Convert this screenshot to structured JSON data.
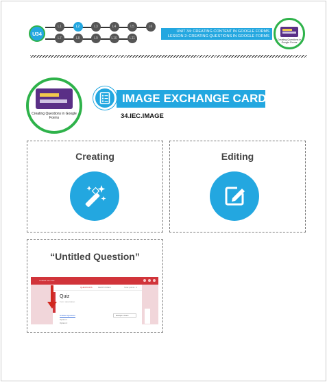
{
  "header": {
    "unit_badge": "U34",
    "lesson_dots_row1": [
      "L1",
      "L2",
      "L3",
      "L4",
      "L5",
      "L6"
    ],
    "lesson_dots_row2": [
      "L7",
      "L8",
      "L9",
      "L10",
      "L11"
    ],
    "active_lesson": "L2",
    "unit_title": "UNIT 34: CREATING CONTENT IN GOOGLE FORMS",
    "lesson_title": "LESSON 2: CREATING QUESTIONS IN GOOGLE FORMS",
    "thumb_caption": "Creating Questions in Google Forms"
  },
  "main": {
    "badge_caption": "Creating Questions in Google Forms",
    "title": "IMAGE EXCHANGE CARDS",
    "code": "34.IEC.IMAGE",
    "title_icon": "list-document-icon"
  },
  "cards": [
    {
      "label": "Creating",
      "icon": "magic-wand-icon"
    },
    {
      "label": "Editing",
      "icon": "edit-square-icon"
    },
    {
      "label": "“Untitled Question”",
      "icon": "screenshot"
    }
  ],
  "screenshot": {
    "app_title": "Untitled form title",
    "tab_questions": "QUESTIONS",
    "tab_responses": "RESPONSES",
    "tab_points": "Total points: 0",
    "form_title": "Quiz",
    "form_desc": "Form description",
    "question": "Untitled Question",
    "question_type": "Multiple choice",
    "options": [
      "Option 1",
      "Option 2"
    ]
  },
  "colors": {
    "accent": "#23a7e0",
    "green": "#2eb24a",
    "purple": "#5a2f86",
    "forms_red": "#d1343a"
  }
}
